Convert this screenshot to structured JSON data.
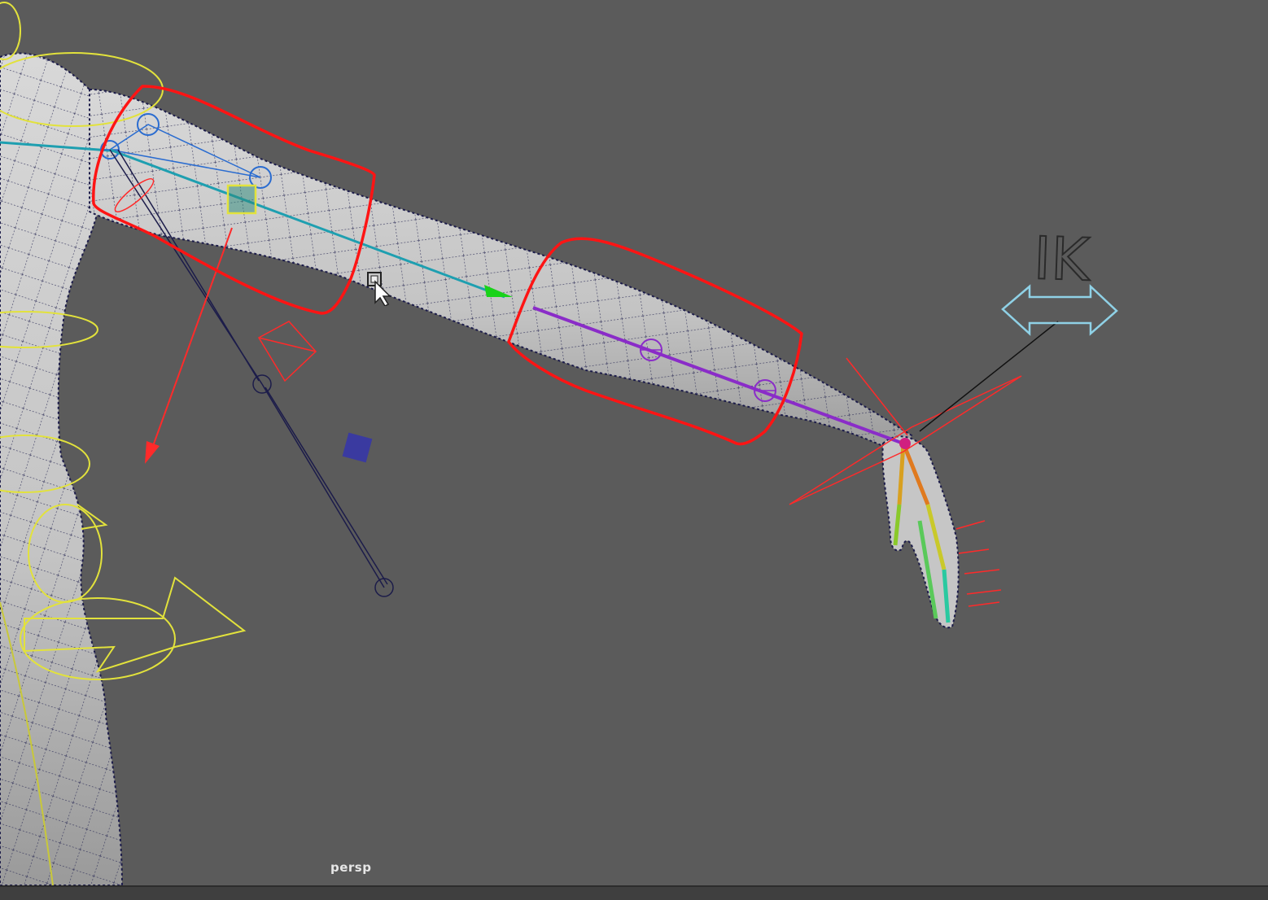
{
  "viewport": {
    "camera_label": "persp"
  },
  "ik_handle": {
    "label": "IK"
  },
  "colors": {
    "background": "#5b5b5b",
    "mesh": "#c9c9c9",
    "wire": "#1c1c4a",
    "annotation": "#ff1414",
    "nurbs_control": "#e2e23c",
    "ik_arrow": "#8fd1e6",
    "forearm_joint": "#8a2cc8",
    "upperarm_joint": "#1e9fb0"
  }
}
